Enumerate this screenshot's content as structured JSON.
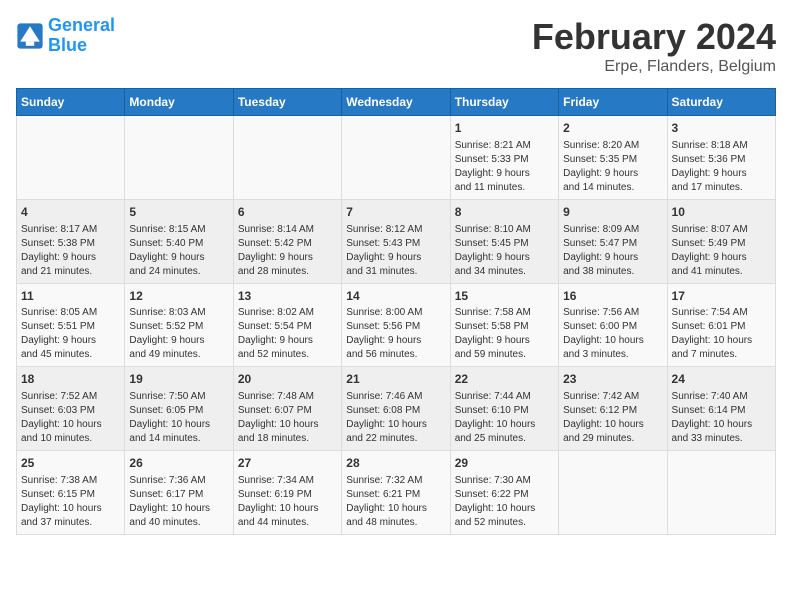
{
  "logo": {
    "line1": "General",
    "line2": "Blue"
  },
  "title": "February 2024",
  "subtitle": "Erpe, Flanders, Belgium",
  "days_header": [
    "Sunday",
    "Monday",
    "Tuesday",
    "Wednesday",
    "Thursday",
    "Friday",
    "Saturday"
  ],
  "weeks": [
    [
      {
        "day": "",
        "info": ""
      },
      {
        "day": "",
        "info": ""
      },
      {
        "day": "",
        "info": ""
      },
      {
        "day": "",
        "info": ""
      },
      {
        "day": "1",
        "info": "Sunrise: 8:21 AM\nSunset: 5:33 PM\nDaylight: 9 hours\nand 11 minutes."
      },
      {
        "day": "2",
        "info": "Sunrise: 8:20 AM\nSunset: 5:35 PM\nDaylight: 9 hours\nand 14 minutes."
      },
      {
        "day": "3",
        "info": "Sunrise: 8:18 AM\nSunset: 5:36 PM\nDaylight: 9 hours\nand 17 minutes."
      }
    ],
    [
      {
        "day": "4",
        "info": "Sunrise: 8:17 AM\nSunset: 5:38 PM\nDaylight: 9 hours\nand 21 minutes."
      },
      {
        "day": "5",
        "info": "Sunrise: 8:15 AM\nSunset: 5:40 PM\nDaylight: 9 hours\nand 24 minutes."
      },
      {
        "day": "6",
        "info": "Sunrise: 8:14 AM\nSunset: 5:42 PM\nDaylight: 9 hours\nand 28 minutes."
      },
      {
        "day": "7",
        "info": "Sunrise: 8:12 AM\nSunset: 5:43 PM\nDaylight: 9 hours\nand 31 minutes."
      },
      {
        "day": "8",
        "info": "Sunrise: 8:10 AM\nSunset: 5:45 PM\nDaylight: 9 hours\nand 34 minutes."
      },
      {
        "day": "9",
        "info": "Sunrise: 8:09 AM\nSunset: 5:47 PM\nDaylight: 9 hours\nand 38 minutes."
      },
      {
        "day": "10",
        "info": "Sunrise: 8:07 AM\nSunset: 5:49 PM\nDaylight: 9 hours\nand 41 minutes."
      }
    ],
    [
      {
        "day": "11",
        "info": "Sunrise: 8:05 AM\nSunset: 5:51 PM\nDaylight: 9 hours\nand 45 minutes."
      },
      {
        "day": "12",
        "info": "Sunrise: 8:03 AM\nSunset: 5:52 PM\nDaylight: 9 hours\nand 49 minutes."
      },
      {
        "day": "13",
        "info": "Sunrise: 8:02 AM\nSunset: 5:54 PM\nDaylight: 9 hours\nand 52 minutes."
      },
      {
        "day": "14",
        "info": "Sunrise: 8:00 AM\nSunset: 5:56 PM\nDaylight: 9 hours\nand 56 minutes."
      },
      {
        "day": "15",
        "info": "Sunrise: 7:58 AM\nSunset: 5:58 PM\nDaylight: 9 hours\nand 59 minutes."
      },
      {
        "day": "16",
        "info": "Sunrise: 7:56 AM\nSunset: 6:00 PM\nDaylight: 10 hours\nand 3 minutes."
      },
      {
        "day": "17",
        "info": "Sunrise: 7:54 AM\nSunset: 6:01 PM\nDaylight: 10 hours\nand 7 minutes."
      }
    ],
    [
      {
        "day": "18",
        "info": "Sunrise: 7:52 AM\nSunset: 6:03 PM\nDaylight: 10 hours\nand 10 minutes."
      },
      {
        "day": "19",
        "info": "Sunrise: 7:50 AM\nSunset: 6:05 PM\nDaylight: 10 hours\nand 14 minutes."
      },
      {
        "day": "20",
        "info": "Sunrise: 7:48 AM\nSunset: 6:07 PM\nDaylight: 10 hours\nand 18 minutes."
      },
      {
        "day": "21",
        "info": "Sunrise: 7:46 AM\nSunset: 6:08 PM\nDaylight: 10 hours\nand 22 minutes."
      },
      {
        "day": "22",
        "info": "Sunrise: 7:44 AM\nSunset: 6:10 PM\nDaylight: 10 hours\nand 25 minutes."
      },
      {
        "day": "23",
        "info": "Sunrise: 7:42 AM\nSunset: 6:12 PM\nDaylight: 10 hours\nand 29 minutes."
      },
      {
        "day": "24",
        "info": "Sunrise: 7:40 AM\nSunset: 6:14 PM\nDaylight: 10 hours\nand 33 minutes."
      }
    ],
    [
      {
        "day": "25",
        "info": "Sunrise: 7:38 AM\nSunset: 6:15 PM\nDaylight: 10 hours\nand 37 minutes."
      },
      {
        "day": "26",
        "info": "Sunrise: 7:36 AM\nSunset: 6:17 PM\nDaylight: 10 hours\nand 40 minutes."
      },
      {
        "day": "27",
        "info": "Sunrise: 7:34 AM\nSunset: 6:19 PM\nDaylight: 10 hours\nand 44 minutes."
      },
      {
        "day": "28",
        "info": "Sunrise: 7:32 AM\nSunset: 6:21 PM\nDaylight: 10 hours\nand 48 minutes."
      },
      {
        "day": "29",
        "info": "Sunrise: 7:30 AM\nSunset: 6:22 PM\nDaylight: 10 hours\nand 52 minutes."
      },
      {
        "day": "",
        "info": ""
      },
      {
        "day": "",
        "info": ""
      }
    ]
  ]
}
